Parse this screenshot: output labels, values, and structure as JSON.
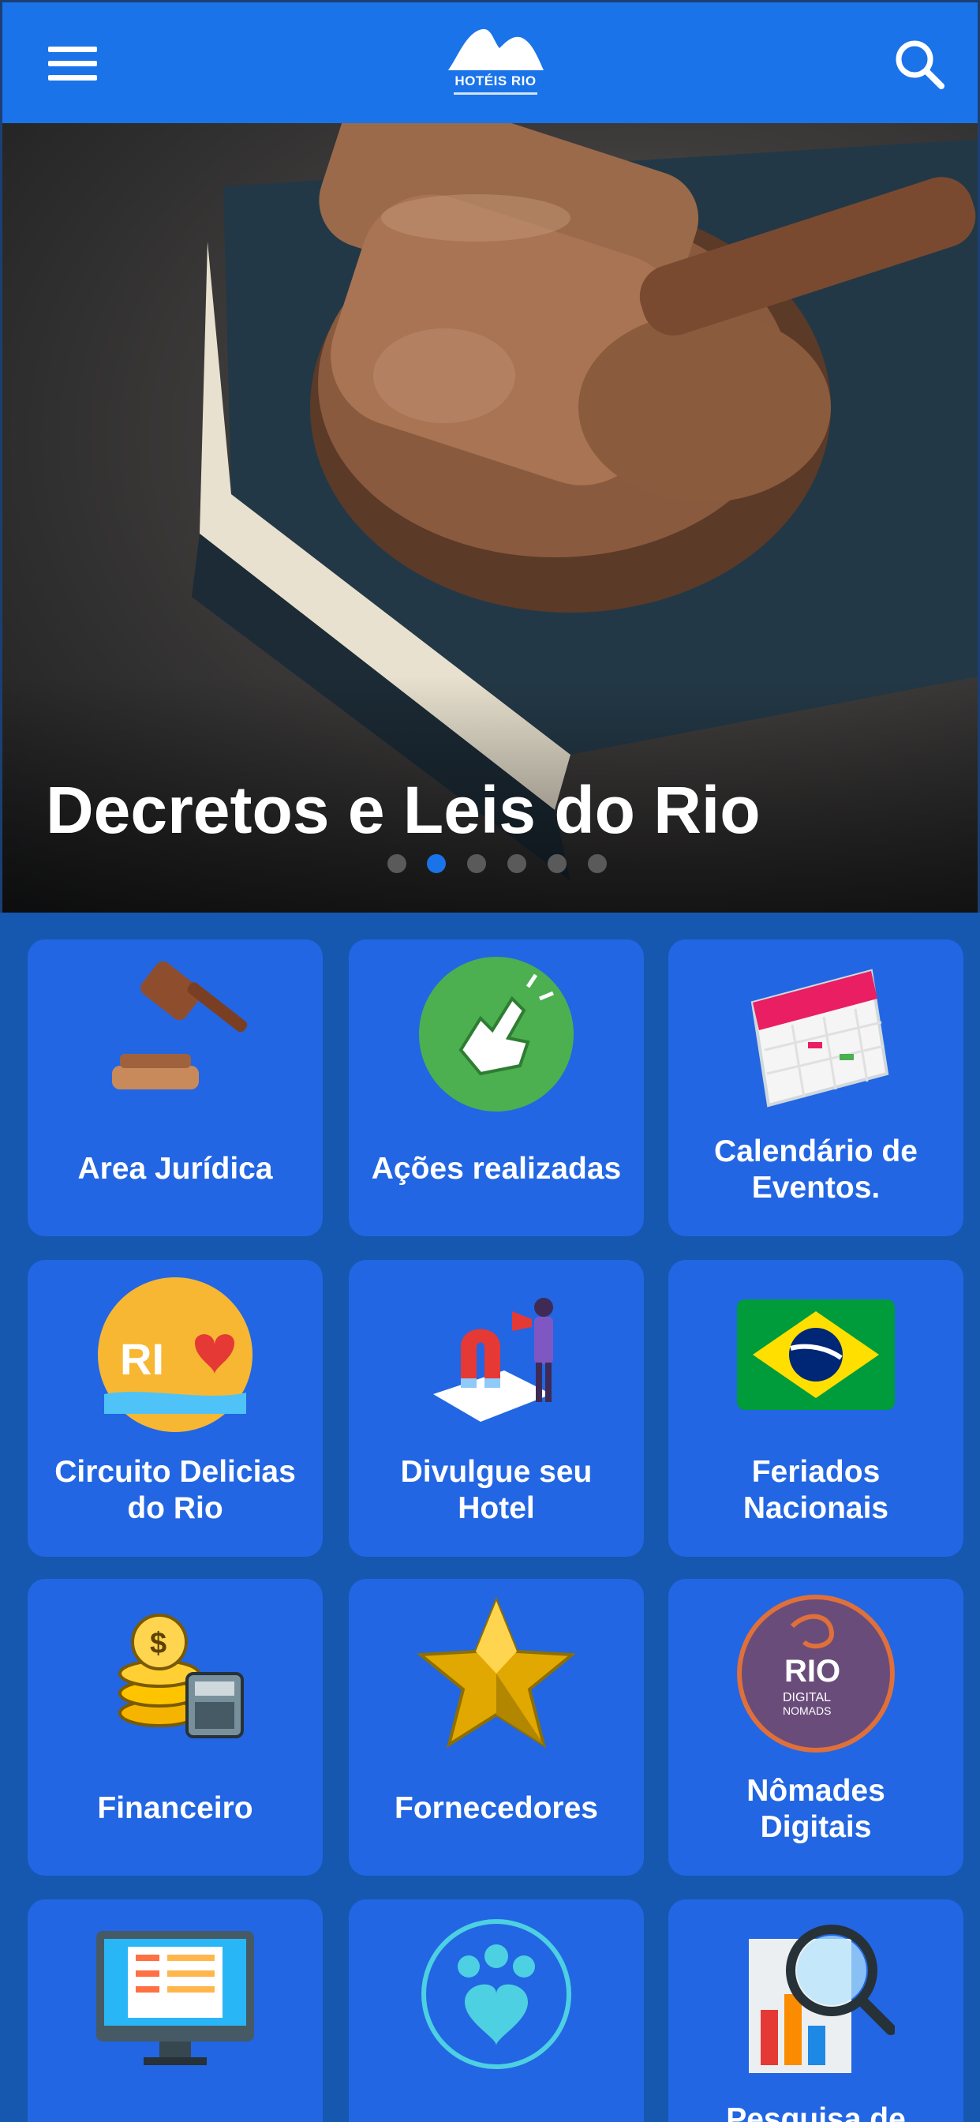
{
  "header": {
    "logo_text": "HOTÉIS RIO",
    "icons": {
      "menu": "hamburger-menu-icon",
      "search": "search-icon"
    }
  },
  "hero": {
    "title": "Decretos e Leis do Rio",
    "slides_total": 6,
    "active_slide": 2
  },
  "tiles": [
    {
      "label": "Area Jurídica",
      "icon": "gavel-icon"
    },
    {
      "label": "Ações realizadas",
      "icon": "thumbs-up-icon"
    },
    {
      "label_line1": "Calendário de",
      "label_line2": "Eventos.",
      "icon": "calendar-icon"
    },
    {
      "label_line1": "Circuito Delicias",
      "label_line2": "do Rio",
      "icon": "circuito-rio-logo-icon"
    },
    {
      "label_line1": "Divulgue seu",
      "label_line2": "Hotel",
      "icon": "magnet-marketing-icon"
    },
    {
      "label_line1": "Feriados",
      "label_line2": "Nacionais",
      "icon": "brazil-flag-icon"
    },
    {
      "label": "Financeiro",
      "icon": "coins-calculator-icon"
    },
    {
      "label": "Fornecedores",
      "icon": "gold-star-icon"
    },
    {
      "label_line1": "Nômades",
      "label_line2": "Digitais",
      "icon": "rio-digital-nomads-badge-icon"
    },
    {
      "label": "",
      "icon": "computer-monitor-icon"
    },
    {
      "label": "",
      "icon": "pet-friendly-paw-icon"
    },
    {
      "label_line1": "Pesquisa de",
      "icon": "research-magnifier-chart-icon"
    }
  ],
  "colors": {
    "header_bg": "#1a73e8",
    "page_bg": "#1657b0",
    "tile_bg": "#2266e3",
    "active_dot": "#1a73e8"
  }
}
